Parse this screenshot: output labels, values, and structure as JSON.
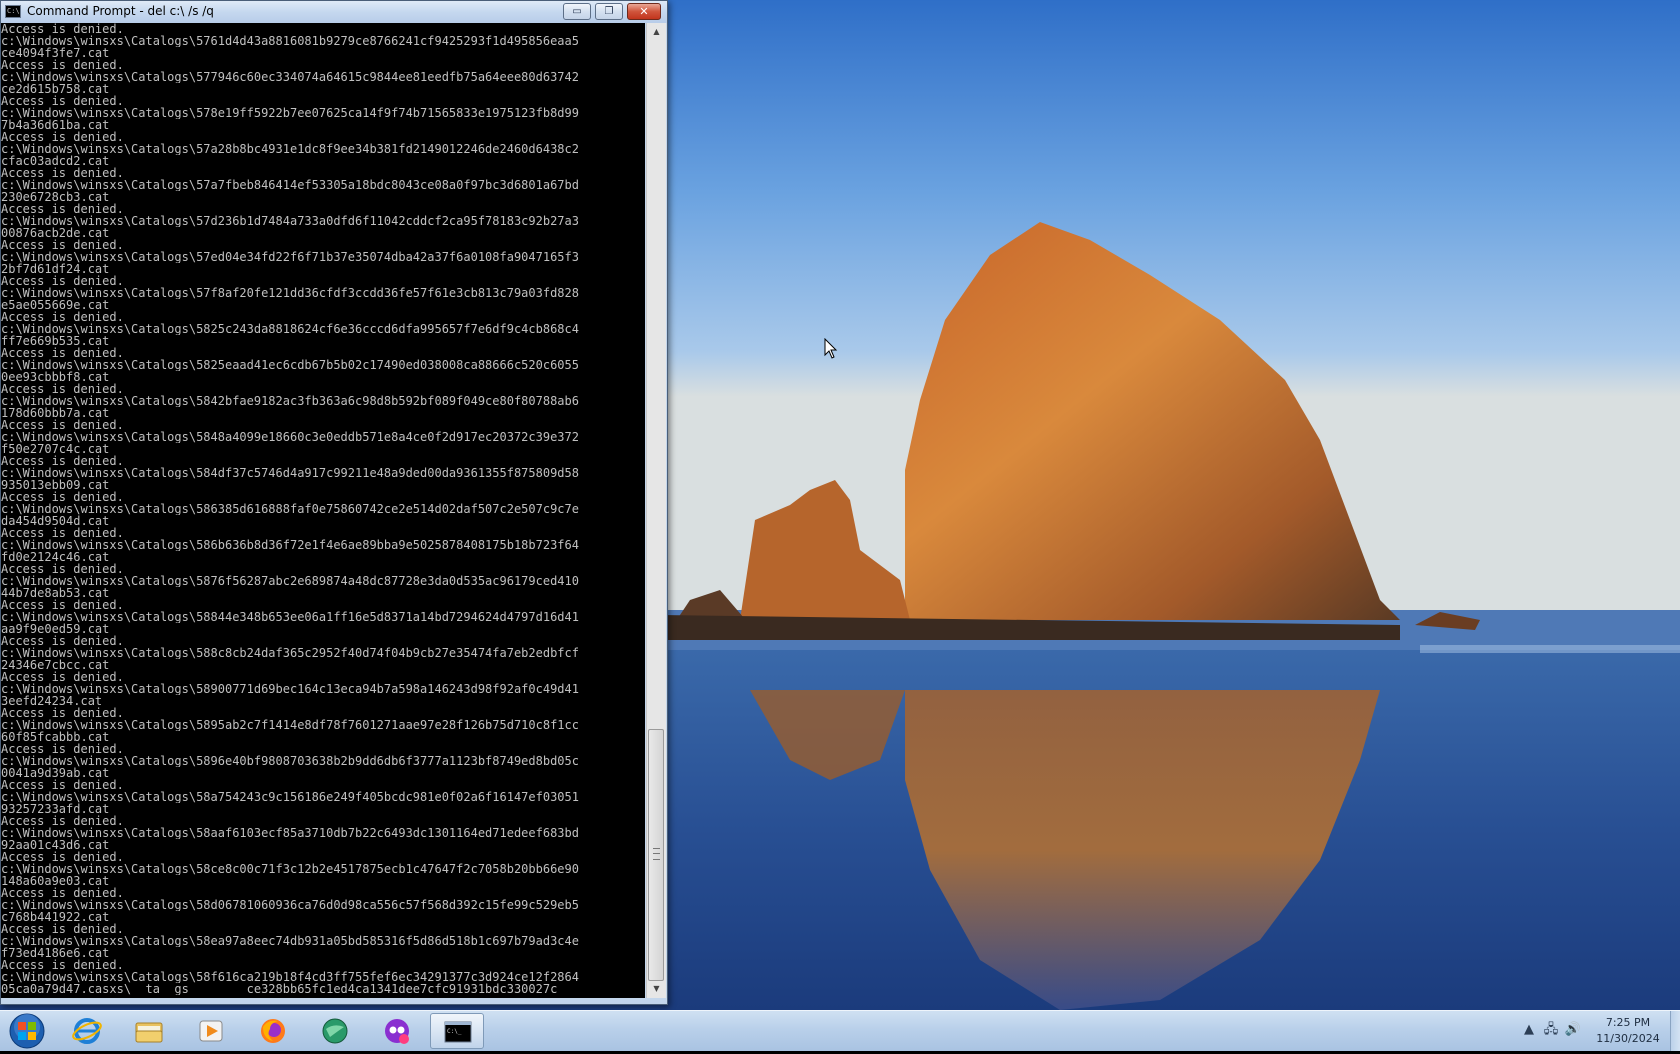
{
  "window": {
    "title": "Command Prompt - del  c:\\ /s /q",
    "icon_text": "C:\\",
    "minimize_glyph": "▭",
    "maximize_glyph": "❐",
    "close_glyph": "✕"
  },
  "console": {
    "lines": [
      "Access is denied.",
      "c:\\Windows\\winsxs\\Catalogs\\5761d4d43a8816081b9279ce8766241cf9425293f1d495856eaa5",
      "ce4094f3fe7.cat",
      "Access is denied.",
      "c:\\Windows\\winsxs\\Catalogs\\577946c60ec334074a64615c9844ee81eedfb75a64eee80d63742",
      "ce2d615b758.cat",
      "Access is denied.",
      "c:\\Windows\\winsxs\\Catalogs\\578e19ff5922b7ee07625ca14f9f74b71565833e1975123fb8d99",
      "7b4a36d61ba.cat",
      "Access is denied.",
      "c:\\Windows\\winsxs\\Catalogs\\57a28b8bc4931e1dc8f9ee34b381fd2149012246de2460d6438c2",
      "cfac03adcd2.cat",
      "Access is denied.",
      "c:\\Windows\\winsxs\\Catalogs\\57a7fbeb846414ef53305a18bdc8043ce08a0f97bc3d6801a67bd",
      "230e6728cb3.cat",
      "Access is denied.",
      "c:\\Windows\\winsxs\\Catalogs\\57d236b1d7484a733a0dfd6f11042cddcf2ca95f78183c92b27a3",
      "00876acb2de.cat",
      "Access is denied.",
      "c:\\Windows\\winsxs\\Catalogs\\57ed04e34fd22f6f71b37e35074dba42a37f6a0108fa9047165f3",
      "2bf7d61df24.cat",
      "Access is denied.",
      "c:\\Windows\\winsxs\\Catalogs\\57f8af20fe121dd36cfdf3ccdd36fe57f61e3cb813c79a03fd828",
      "e5ae055669e.cat",
      "Access is denied.",
      "c:\\Windows\\winsxs\\Catalogs\\5825c243da8818624cf6e36cccd6dfa995657f7e6df9c4cb868c4",
      "ff7e669b535.cat",
      "Access is denied.",
      "c:\\Windows\\winsxs\\Catalogs\\5825eaad41ec6cdb67b5b02c17490ed038008ca88666c520c6055",
      "0ee93cbbbf8.cat",
      "Access is denied.",
      "c:\\Windows\\winsxs\\Catalogs\\5842bfae9182ac3fb363a6c98d8b592bf089f049ce80f80788ab6",
      "178d60bbb7a.cat",
      "Access is denied.",
      "c:\\Windows\\winsxs\\Catalogs\\5848a4099e18660c3e0eddb571e8a4ce0f2d917ec20372c39e372",
      "f50e2707c4c.cat",
      "Access is denied.",
      "c:\\Windows\\winsxs\\Catalogs\\584df37c5746d4a917c99211e48a9ded00da9361355f875809d58",
      "935013ebb09.cat",
      "Access is denied.",
      "c:\\Windows\\winsxs\\Catalogs\\586385d616888faf0e75860742ce2e514d02daf507c2e507c9c7e",
      "da454d9504d.cat",
      "Access is denied.",
      "c:\\Windows\\winsxs\\Catalogs\\586b636b8d36f72e1f4e6ae89bba9e5025878408175b18b723f64",
      "fd0e2124c46.cat",
      "Access is denied.",
      "c:\\Windows\\winsxs\\Catalogs\\5876f56287abc2e689874a48dc87728e3da0d535ac96179ced410",
      "44b7de8ab53.cat",
      "Access is denied.",
      "c:\\Windows\\winsxs\\Catalogs\\58844e348b653ee06a1ff16e5d8371a14bd7294624d4797d16d41",
      "aa9f9e0ed59.cat",
      "Access is denied.",
      "c:\\Windows\\winsxs\\Catalogs\\588c8cb24daf365c2952f40d74f04b9cb27e35474fa7eb2edbfcf",
      "24346e7cbcc.cat",
      "Access is denied.",
      "c:\\Windows\\winsxs\\Catalogs\\58900771d69bec164c13eca94b7a598a146243d98f92af0c49d41",
      "3eefd24234.cat",
      "Access is denied.",
      "c:\\Windows\\winsxs\\Catalogs\\5895ab2c7f1414e8df78f7601271aae97e28f126b75d710c8f1cc",
      "60f85fcabbb.cat",
      "Access is denied.",
      "c:\\Windows\\winsxs\\Catalogs\\5896e40bf9808703638b2b9dd6db6f3777a1123bf8749ed8bd05c",
      "0041a9d39ab.cat",
      "Access is denied.",
      "c:\\Windows\\winsxs\\Catalogs\\58a754243c9c156186e249f405bcdc981e0f02a6f16147ef03051",
      "93257233afd.cat",
      "Access is denied.",
      "c:\\Windows\\winsxs\\Catalogs\\58aaf6103ecf85a3710db7b22c6493dc1301164ed71edeef683bd",
      "92aa01c43d6.cat",
      "Access is denied.",
      "c:\\Windows\\winsxs\\Catalogs\\58ce8c00c71f3c12b2e4517875ecb1c47647f2c7058b20bb66e90",
      "148a60a9e03.cat",
      "Access is denied.",
      "c:\\Windows\\winsxs\\Catalogs\\58d06781060936ca76d0d98ca556c57f568d392c15fe99c529eb5",
      "c768b441922.cat",
      "Access is denied.",
      "c:\\Windows\\winsxs\\Catalogs\\58ea97a8eec74db931a05bd585316f5d86d518b1c697b79ad3c4e",
      "f73ed4186e6.cat",
      "Access is denied.",
      "c:\\Windows\\winsxs\\Catalogs\\58f616ca219b18f4cd3ff755fef6ec34291377c3d924ce12f2864",
      "05ca0a79d47.casxs\\  ta  gs        ce328bb65fc1ed4ca1341dee7cfc91931bdc330027c"
    ]
  },
  "taskbar": {
    "apps": [
      {
        "name": "internet-explorer",
        "label": "Internet Explorer"
      },
      {
        "name": "file-explorer",
        "label": "Windows Explorer"
      },
      {
        "name": "media-player",
        "label": "Windows Media Player"
      },
      {
        "name": "firefox",
        "label": "Firefox"
      },
      {
        "name": "green-app",
        "label": "App"
      },
      {
        "name": "purple-app",
        "label": "App"
      },
      {
        "name": "command-prompt",
        "label": "Command Prompt",
        "active": true
      }
    ],
    "tray_icons": [
      "show-hidden-icons",
      "network-icon",
      "volume-icon"
    ],
    "clock_time": "7:25 PM",
    "clock_date": "11/30/2024"
  },
  "colors": {
    "console_bg": "#000000",
    "console_text": "#c0c0c0",
    "taskbar_bg": "#b9d0ea",
    "close_button": "#c2351d"
  }
}
